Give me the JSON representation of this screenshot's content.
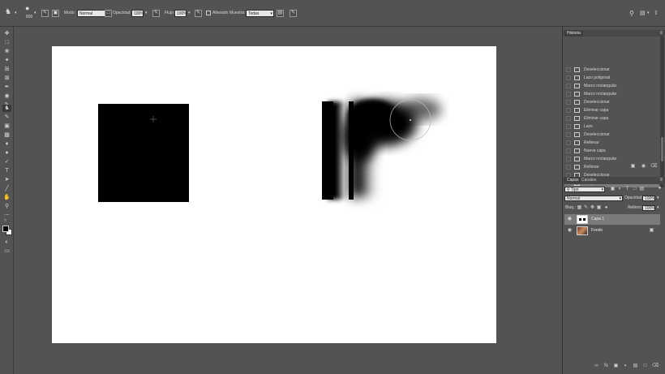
{
  "options_bar": {
    "tool_icon": "clone-stamp-icon",
    "brush_size": "800",
    "mode_label": "Modo:",
    "mode_value": "Normal",
    "opacity_label": "Opacidad:",
    "opacity_value": "100%",
    "flow_label": "Flujo:",
    "flow_value": "100%",
    "aligned_label": "Alineado",
    "sample_label": "Muestra:",
    "sample_value": "Todas"
  },
  "history_panel": {
    "tab_label": "Historia",
    "items": [
      {
        "label": "Deseleccionar",
        "icon": "history-state-icon"
      },
      {
        "label": "Lazo poligonal",
        "icon": "polygonal-lasso-icon"
      },
      {
        "label": "Marco rectangular",
        "icon": "rectangular-marquee-icon"
      },
      {
        "label": "Marco rectangular",
        "icon": "rectangular-marquee-icon"
      },
      {
        "label": "Deseleccionar",
        "icon": "history-state-icon"
      },
      {
        "label": "Eliminar capa",
        "icon": "history-state-icon"
      },
      {
        "label": "Eliminar capa",
        "icon": "history-state-icon"
      },
      {
        "label": "Lazo",
        "icon": "lasso-icon"
      },
      {
        "label": "Deseleccionar",
        "icon": "history-state-icon"
      },
      {
        "label": "Rellenar",
        "icon": "history-state-icon"
      },
      {
        "label": "Nueva capa",
        "icon": "history-state-icon"
      },
      {
        "label": "Marco rectangular",
        "icon": "rectangular-marquee-icon"
      },
      {
        "label": "Rellenar",
        "icon": "history-state-icon"
      },
      {
        "label": "Deseleccionar",
        "icon": "history-state-icon"
      },
      {
        "label": "Tampón de clonar",
        "icon": "clone-stamp-icon",
        "active": true
      }
    ]
  },
  "layers_panel": {
    "tab_layers": "Capas",
    "tab_channels": "Canales",
    "filter_label": "Tipo",
    "blend_mode": "Normal",
    "opacity_label": "Opacidad:",
    "opacity_value": "100%",
    "lock_label": "Bloq.:",
    "fill_label": "Relleno:",
    "fill_value": "100%",
    "layers": [
      {
        "name": "Capa 1",
        "visible": true,
        "active": true
      },
      {
        "name": "Fondo",
        "visible": true,
        "locked": true
      }
    ]
  },
  "colors": {
    "ui_bg": "#535353",
    "canvas": "#ffffff",
    "foreground": "#000000",
    "background": "#ffffff",
    "active_row": "#7a7a7a"
  }
}
